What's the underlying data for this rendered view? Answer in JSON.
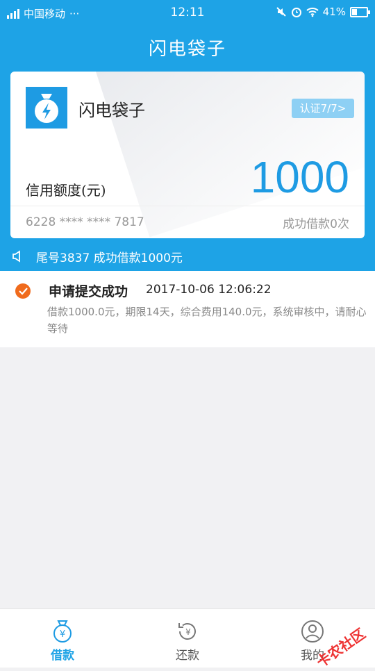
{
  "status_bar": {
    "carrier": "中国移动",
    "dots": "···",
    "time": "12:11",
    "battery": "41%",
    "battery_level": 0.41
  },
  "header": {
    "title": "闪电袋子"
  },
  "card": {
    "app_name": "闪电袋子",
    "cert_label": "认证7/7>",
    "limit_label": "信用额度(元)",
    "limit_value": "1000",
    "card_number": "6228 **** **** 7817",
    "borrow_count": "成功借款0次"
  },
  "notice": {
    "text": "尾号3837 成功借款1000元"
  },
  "record": {
    "title": "申请提交成功",
    "time": "2017-10-06 12:06:22",
    "description": "借款1000.0元，期限14天，综合费用140.0元，系统审核中，请耐心等待"
  },
  "tabs": [
    {
      "label": "借款",
      "icon": "money-bag-icon",
      "active": true
    },
    {
      "label": "还款",
      "icon": "repay-icon",
      "active": false
    },
    {
      "label": "我的",
      "icon": "user-icon",
      "active": false
    }
  ],
  "watermark": {
    "text": "卡农社区"
  },
  "colors": {
    "primary": "#1ea3e6",
    "accent": "#f06b1c",
    "inactive": "#555555"
  }
}
